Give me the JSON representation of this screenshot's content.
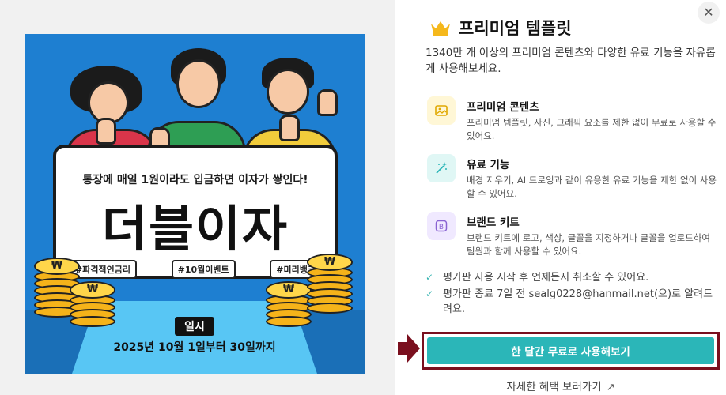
{
  "preview": {
    "subtitle": "통장에 매일 1원이라도 입금하면 이자가 쌓인다!",
    "headline": "더블이자",
    "tags": [
      "#파격적인금리",
      "#10월이벤트",
      "#미리뱅크"
    ],
    "badge": "일시",
    "date": "2025년 10월 1일부터 30일까지"
  },
  "panel": {
    "close_icon": "close-icon",
    "title": "프리미엄 템플릿",
    "description": "1340만 개 이상의 프리미엄 콘텐츠와 다양한 유료 기능을 자유롭게 사용해보세요.",
    "features": [
      {
        "icon": "image-icon",
        "name": "프리미엄 콘텐츠",
        "desc": "프리미엄 템플릿, 사진, 그래픽 요소를 제한 없이 무료로 사용할 수 있어요."
      },
      {
        "icon": "magic-wand-icon",
        "name": "유료 기능",
        "desc": "배경 지우기, AI 드로잉과 같이 유용한 유료 기능을 제한 없이 사용할 수 있어요."
      },
      {
        "icon": "brand-kit-icon",
        "name": "브랜드 키트",
        "desc": "브랜드 키트에 로고, 색상, 글꼴을 지정하거나 글꼴을 업로드하여 팀원과 함께 사용할 수 있어요."
      }
    ],
    "checks": [
      "평가판 사용 시작 후 언제든지 취소할 수 있어요.",
      "평가판 종료 7일 전 sealg0228@hanmail.net(으)로 알려드려요."
    ],
    "cta_label": "한 달간 무료로 사용해보기",
    "more_link": "자세한 혜택 보러가기",
    "colors": {
      "accent": "#2bb6b8",
      "highlight_border": "#7a0f1e",
      "crown": "#f5b81c"
    }
  }
}
